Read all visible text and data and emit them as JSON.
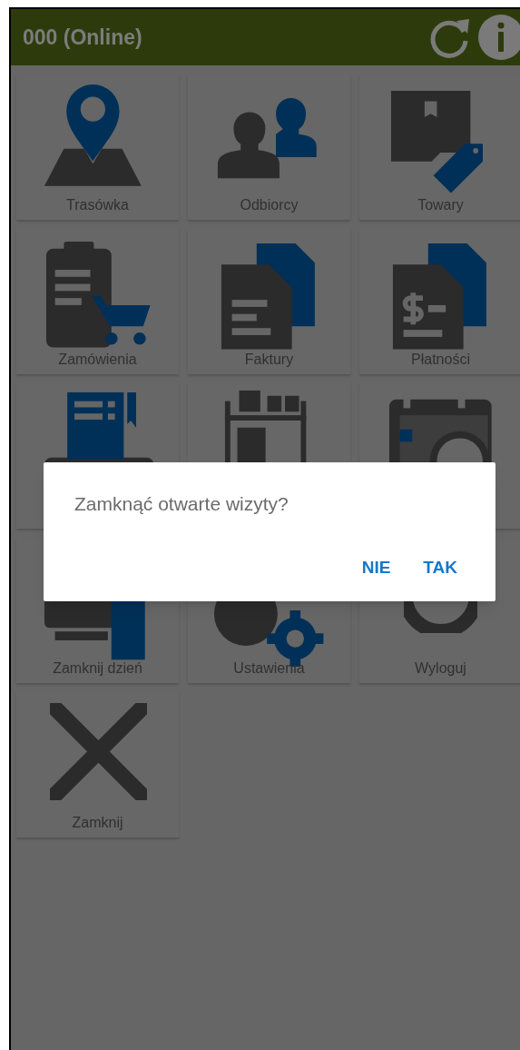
{
  "header": {
    "title": "000 (Online)"
  },
  "tiles": [
    {
      "kind": "route",
      "label": "Trasówka"
    },
    {
      "kind": "customers",
      "label": "Odbiorcy"
    },
    {
      "kind": "goods",
      "label": "Towary"
    },
    {
      "kind": "orders",
      "label": "Zamówienia"
    },
    {
      "kind": "invoices",
      "label": "Faktury"
    },
    {
      "kind": "payments",
      "label": "Płatności"
    },
    {
      "kind": "receipt"
    },
    {
      "kind": "warehouse"
    },
    {
      "kind": "calendar"
    },
    {
      "kind": "closeday",
      "label": "Zamknij dzień"
    },
    {
      "kind": "settings",
      "label": "Ustawienia"
    },
    {
      "kind": "logout",
      "label": "Wyloguj"
    },
    {
      "kind": "close",
      "label": "Zamknij"
    }
  ],
  "dialog": {
    "message": "Zamknąć otwarte wizyty?",
    "buttons": [
      "NIE",
      "TAK"
    ]
  }
}
